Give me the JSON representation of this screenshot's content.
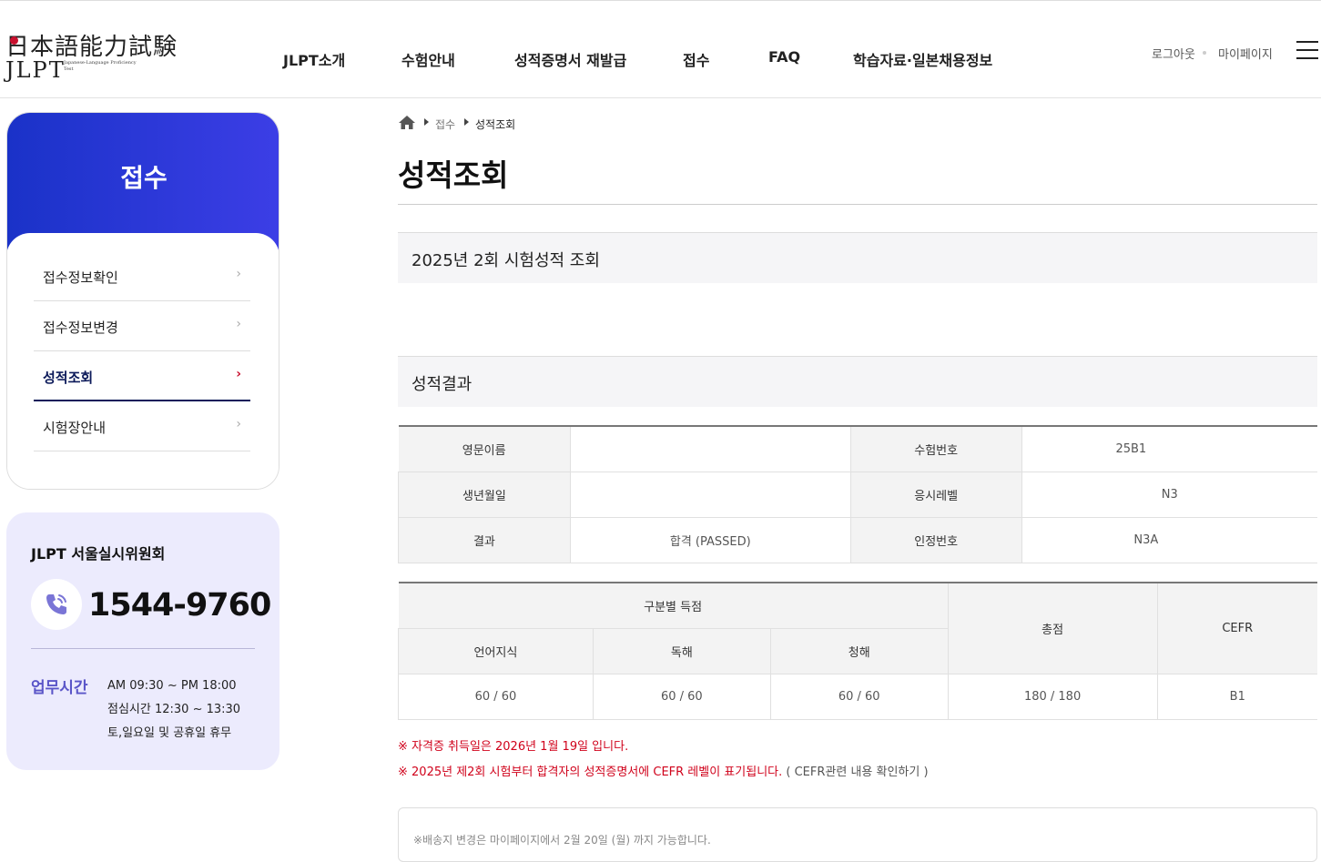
{
  "header": {
    "logo_kanji": "日本語能力試験",
    "logo_jlpt": "JLPT",
    "logo_sub": "Japanese-Language Proficiency Test",
    "nav": [
      "JLPT소개",
      "수험안내",
      "성적증명서 재발급",
      "접수",
      "FAQ",
      "학습자료·일본채용정보"
    ],
    "logout": "로그아웃",
    "mypage": "마이페이지"
  },
  "sidebar": {
    "title": "접수",
    "items": [
      {
        "label": "접수정보확인",
        "active": false
      },
      {
        "label": "접수정보변경",
        "active": false
      },
      {
        "label": "성적조회",
        "active": true
      },
      {
        "label": "시험장안내",
        "active": false
      }
    ],
    "arrow": "›"
  },
  "contact": {
    "org": "JLPT 서울실시위원회",
    "phone": "1544-9760",
    "hours_label": "업무시간",
    "hours": [
      "AM 09:30 ~ PM 18:00",
      "점심시간 12:30 ~ 13:30",
      "토,일요일 및 공휴일 휴무"
    ]
  },
  "breadcrumb": [
    "접수",
    "성적조회"
  ],
  "page_title": "성적조회",
  "exam_section": "2025년 2회 시험성적 조회",
  "result_section": "성적결과",
  "info_table": {
    "rows": [
      {
        "l1": "영문이름",
        "v1": "",
        "l2": "수험번호",
        "v2": "25B1"
      },
      {
        "l1": "생년월일",
        "v1": "",
        "l2": "응시레벨",
        "v2": "N3"
      },
      {
        "l1": "결과",
        "v1": "합격 (PASSED)",
        "l2": "인정번호",
        "v2": "N3A"
      }
    ]
  },
  "score_table": {
    "group_header": "구분별 득점",
    "sub_headers": [
      "언어지식",
      "독해",
      "청해"
    ],
    "total_header": "총점",
    "cefr_header": "CEFR",
    "values": [
      "60 / 60",
      "60 / 60",
      "60 / 60"
    ],
    "total": "180 / 180",
    "cefr": "B1"
  },
  "notes": {
    "line1": "※ 자격증 취득일은 2026년 1월 19일 입니다.",
    "line2": "※ 2025년 제2회 시험부터 합격자의 성적증명서에 CEFR 레벨이 표기됩니다.",
    "line2_link": "( CEFR관련 내용 확인하기 )"
  },
  "bottom_text": "※배송지 변경은 마이페이지에서 2월 20일 (월) 까지 가능합니다."
}
